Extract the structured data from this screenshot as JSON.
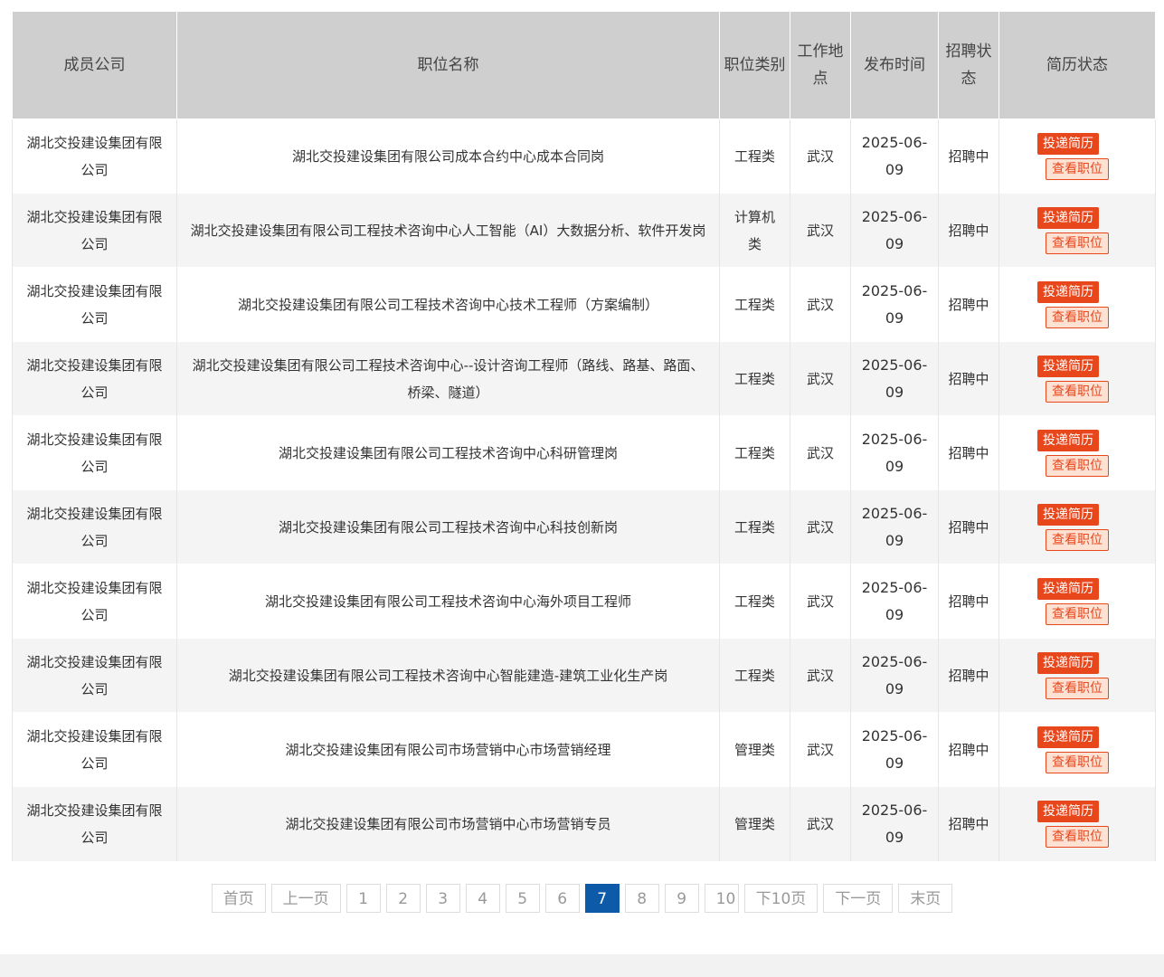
{
  "table": {
    "headers": {
      "company": "成员公司",
      "position": "职位名称",
      "category": "职位类别",
      "location": "工作地点",
      "date": "发布时间",
      "status": "招聘状态",
      "resume": "简历状态"
    },
    "apply_label": "投递简历",
    "view_label": "查看职位",
    "rows": [
      {
        "company": "湖北交投建设集团有限公司",
        "position": "湖北交投建设集团有限公司成本合约中心成本合同岗",
        "category": "工程类",
        "location": "武汉",
        "date": "2025-06-09",
        "status": "招聘中"
      },
      {
        "company": "湖北交投建设集团有限公司",
        "position": "湖北交投建设集团有限公司工程技术咨询中心人工智能（AI）大数据分析、软件开发岗",
        "category": "计算机类",
        "location": "武汉",
        "date": "2025-06-09",
        "status": "招聘中"
      },
      {
        "company": "湖北交投建设集团有限公司",
        "position": "湖北交投建设集团有限公司工程技术咨询中心技术工程师（方案编制）",
        "category": "工程类",
        "location": "武汉",
        "date": "2025-06-09",
        "status": "招聘中"
      },
      {
        "company": "湖北交投建设集团有限公司",
        "position": "湖北交投建设集团有限公司工程技术咨询中心--设计咨询工程师（路线、路基、路面、桥梁、隧道）",
        "category": "工程类",
        "location": "武汉",
        "date": "2025-06-09",
        "status": "招聘中"
      },
      {
        "company": "湖北交投建设集团有限公司",
        "position": "湖北交投建设集团有限公司工程技术咨询中心科研管理岗",
        "category": "工程类",
        "location": "武汉",
        "date": "2025-06-09",
        "status": "招聘中"
      },
      {
        "company": "湖北交投建设集团有限公司",
        "position": "湖北交投建设集团有限公司工程技术咨询中心科技创新岗",
        "category": "工程类",
        "location": "武汉",
        "date": "2025-06-09",
        "status": "招聘中"
      },
      {
        "company": "湖北交投建设集团有限公司",
        "position": "湖北交投建设集团有限公司工程技术咨询中心海外项目工程师",
        "category": "工程类",
        "location": "武汉",
        "date": "2025-06-09",
        "status": "招聘中"
      },
      {
        "company": "湖北交投建设集团有限公司",
        "position": "湖北交投建设集团有限公司工程技术咨询中心智能建造-建筑工业化生产岗",
        "category": "工程类",
        "location": "武汉",
        "date": "2025-06-09",
        "status": "招聘中"
      },
      {
        "company": "湖北交投建设集团有限公司",
        "position": "湖北交投建设集团有限公司市场营销中心市场营销经理",
        "category": "管理类",
        "location": "武汉",
        "date": "2025-06-09",
        "status": "招聘中"
      },
      {
        "company": "湖北交投建设集团有限公司",
        "position": "湖北交投建设集团有限公司市场营销中心市场营销专员",
        "category": "管理类",
        "location": "武汉",
        "date": "2025-06-09",
        "status": "招聘中"
      }
    ]
  },
  "pagination": {
    "first": "首页",
    "prev": "上一页",
    "pages": [
      "1",
      "2",
      "3",
      "4",
      "5",
      "6",
      "7",
      "8",
      "9",
      "10"
    ],
    "current": "7",
    "next10": "下10页",
    "next": "下一页",
    "last": "末页"
  },
  "colors": {
    "apply_bg": "#e8461b",
    "view_bg": "#fde2d4",
    "current_page": "#0d5ba8",
    "header_bg": "#cfcfcf"
  }
}
